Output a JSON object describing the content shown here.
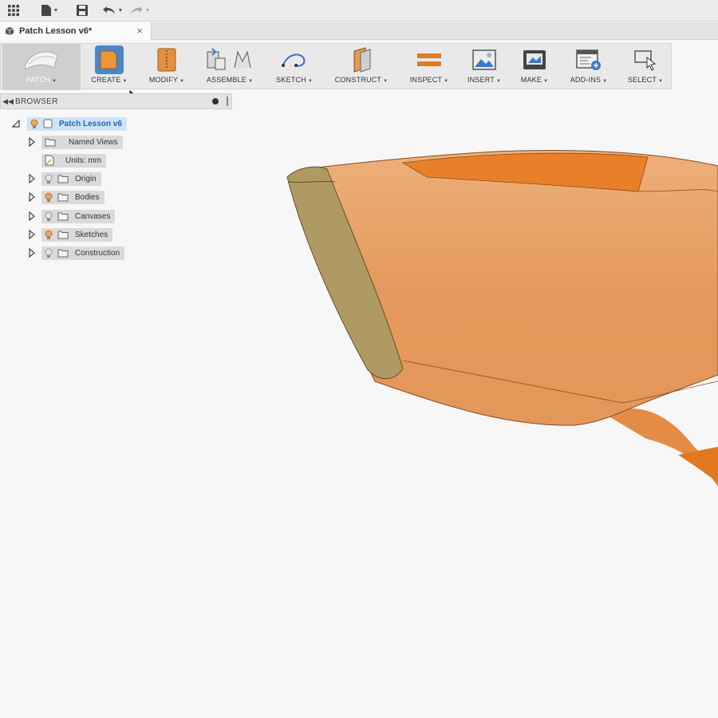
{
  "document": {
    "tab_title": "Patch Lesson v6*"
  },
  "toolbar": {
    "workspace": "PATCH",
    "groups": [
      {
        "key": "create",
        "label": "CREATE"
      },
      {
        "key": "modify",
        "label": "MODIFY"
      },
      {
        "key": "assemble",
        "label": "ASSEMBLE"
      },
      {
        "key": "sketch",
        "label": "SKETCH"
      },
      {
        "key": "construct",
        "label": "CONSTRUCT"
      },
      {
        "key": "inspect",
        "label": "INSPECT"
      },
      {
        "key": "insert",
        "label": "INSERT"
      },
      {
        "key": "make",
        "label": "MAKE"
      },
      {
        "key": "addins",
        "label": "ADD-INS"
      },
      {
        "key": "select",
        "label": "SELECT"
      }
    ]
  },
  "browser": {
    "title": "BROWSER",
    "root": "Patch Lesson v6",
    "items": [
      {
        "label": "Named Views"
      },
      {
        "label": "Units: mm"
      },
      {
        "label": "Origin"
      },
      {
        "label": "Bodies"
      },
      {
        "label": "Canvases"
      },
      {
        "label": "Sketches"
      },
      {
        "label": "Construction"
      }
    ]
  },
  "icons": {
    "grid": "app-grid-icon",
    "file": "file-icon",
    "save": "save-icon",
    "undo": "undo-icon",
    "redo": "redo-icon",
    "close": "close-icon",
    "bulb": "lightbulb-icon",
    "folder": "folder-icon"
  },
  "colors": {
    "model_orange": "#e8964f",
    "accent_orange": "#e97b22",
    "selection_blue": "#cde4f7",
    "chip_gray": "#dadada"
  }
}
